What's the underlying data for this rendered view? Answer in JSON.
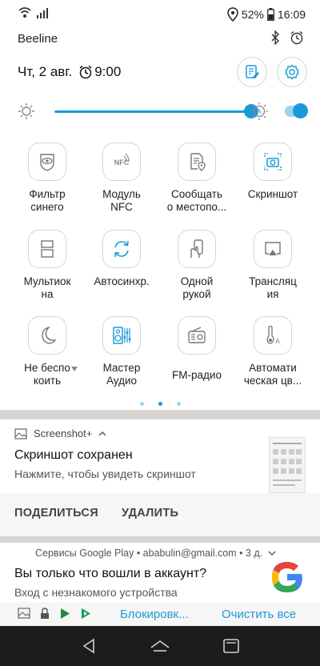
{
  "status_bar": {
    "battery_percent": "52%",
    "time": "16:09",
    "icons": [
      "wifi-icon",
      "signal-icon",
      "location-icon",
      "battery-icon"
    ]
  },
  "carrier": "Beeline",
  "header": {
    "date": "Чт, 2 авг.",
    "alarm": "9:00",
    "icons": [
      "bluetooth-icon",
      "alarm-icon",
      "edit-icon",
      "settings-icon"
    ]
  },
  "brightness": {
    "level": 0.92,
    "auto": true
  },
  "tiles": [
    {
      "label": "Фильтр\nсинего",
      "icon": "blue-filter-icon",
      "active": false
    },
    {
      "label": "Модуль\nNFC",
      "icon": "nfc-icon",
      "active": false
    },
    {
      "label": "Сообщать\nо местопо...",
      "icon": "location-report-icon",
      "active": false
    },
    {
      "label": "Скриншот",
      "icon": "screenshot-icon",
      "active": true
    },
    {
      "label": "Мультиок\nна",
      "icon": "multiwindow-icon",
      "active": false
    },
    {
      "label": "Автосинхр.",
      "icon": "sync-icon",
      "active": true
    },
    {
      "label": "Одной\nрукой",
      "icon": "one-hand-icon",
      "active": false
    },
    {
      "label": "Трансляц\nия",
      "icon": "cast-icon",
      "active": false
    },
    {
      "label": "Не беспо\nкоить",
      "icon": "moon-icon",
      "active": false
    },
    {
      "label": "Мастер\nАудио",
      "icon": "audio-master-icon",
      "active": true
    },
    {
      "label": "FM-радио",
      "icon": "radio-icon",
      "active": false
    },
    {
      "label": "Автомати\nческая цв...",
      "icon": "auto-color-icon",
      "active": false
    }
  ],
  "page_indicator": {
    "count": 3,
    "active_index": 1
  },
  "notification_screenshot": {
    "app": "Screenshot+",
    "title": "Скриншот сохранен",
    "subtitle": "Нажмите, чтобы увидеть скриншот",
    "actions": [
      "ПОДЕЛИТЬСЯ",
      "УДАЛИТЬ"
    ]
  },
  "notification_google": {
    "header": "Сервисы Google Play • ababulin@gmail.com • 3 д.",
    "title": "Вы только что вошли в аккаунт?",
    "subtitle": "Вход с незнакомого устройства",
    "action_block": "Блокировк...",
    "action_clear": "Очистить все"
  },
  "colors": {
    "accent": "#1a9bd7",
    "nav": "#1c1c1c"
  }
}
